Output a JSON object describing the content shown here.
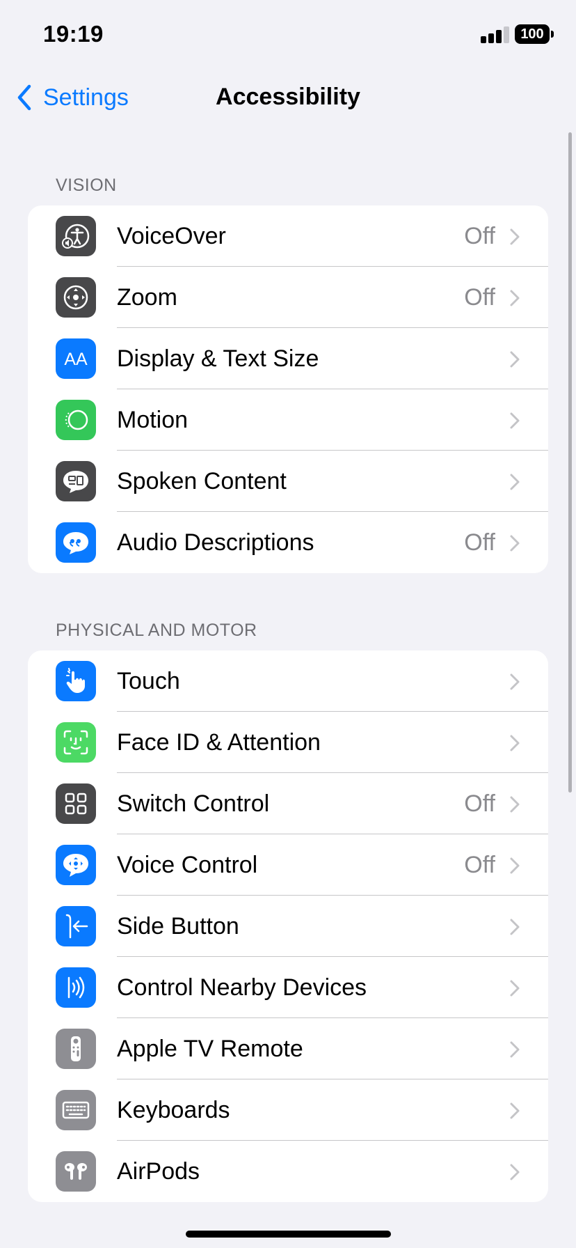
{
  "status_bar": {
    "time": "19:19",
    "battery": "100"
  },
  "nav": {
    "back_label": "Settings",
    "title": "Accessibility"
  },
  "sections": [
    {
      "header": "VISION",
      "rows": [
        {
          "label": "VoiceOver",
          "value": "Off",
          "icon": "voiceover-icon",
          "color": "#48484a"
        },
        {
          "label": "Zoom",
          "value": "Off",
          "icon": "zoom-icon",
          "color": "#48484a"
        },
        {
          "label": "Display & Text Size",
          "value": "",
          "icon": "text-size-icon",
          "color": "#0a7aff"
        },
        {
          "label": "Motion",
          "value": "",
          "icon": "motion-icon",
          "color": "#34c759"
        },
        {
          "label": "Spoken Content",
          "value": "",
          "icon": "spoken-content-icon",
          "color": "#48484a"
        },
        {
          "label": "Audio Descriptions",
          "value": "Off",
          "icon": "audio-descriptions-icon",
          "color": "#0a7aff"
        }
      ]
    },
    {
      "header": "PHYSICAL AND MOTOR",
      "rows": [
        {
          "label": "Touch",
          "value": "",
          "icon": "touch-hand-icon",
          "color": "#0a7aff"
        },
        {
          "label": "Face ID & Attention",
          "value": "",
          "icon": "face-id-icon",
          "color": "#4cd964"
        },
        {
          "label": "Switch Control",
          "value": "Off",
          "icon": "switch-control-icon",
          "color": "#48484a"
        },
        {
          "label": "Voice Control",
          "value": "Off",
          "icon": "voice-control-icon",
          "color": "#0a7aff"
        },
        {
          "label": "Side Button",
          "value": "",
          "icon": "side-button-icon",
          "color": "#0a7aff"
        },
        {
          "label": "Control Nearby Devices",
          "value": "",
          "icon": "nearby-devices-icon",
          "color": "#0a7aff"
        },
        {
          "label": "Apple TV Remote",
          "value": "",
          "icon": "tv-remote-icon",
          "color": "#8e8e93"
        },
        {
          "label": "Keyboards",
          "value": "",
          "icon": "keyboard-icon",
          "color": "#8e8e93"
        },
        {
          "label": "AirPods",
          "value": "",
          "icon": "airpods-icon",
          "color": "#8e8e93"
        }
      ]
    }
  ]
}
